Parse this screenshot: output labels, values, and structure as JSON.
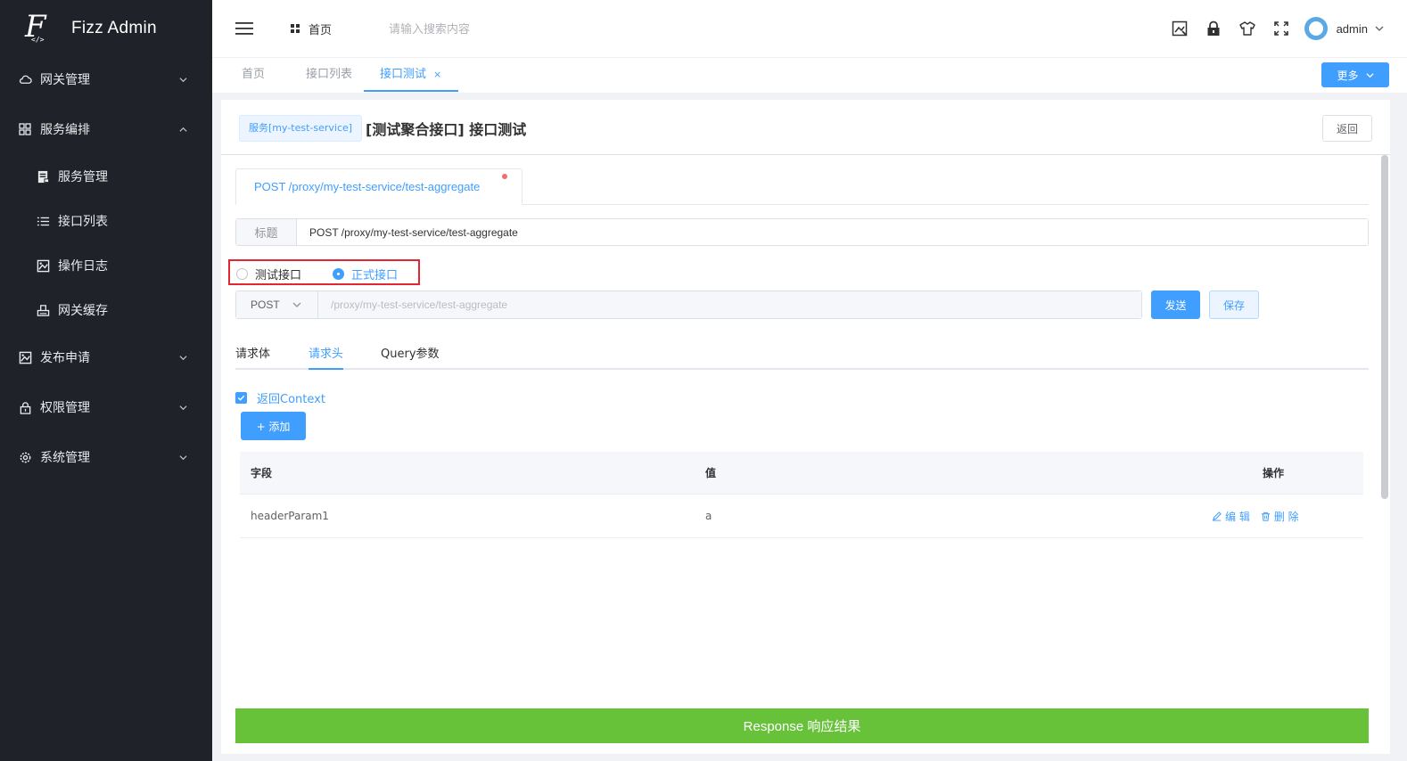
{
  "app": {
    "title": "Fizz Admin",
    "logo_code": "</>"
  },
  "sidebar": {
    "items": [
      {
        "label": "网关管理",
        "icon": "cloud-icon",
        "expanded": false
      },
      {
        "label": "服务编排",
        "icon": "grid-icon",
        "expanded": true
      },
      {
        "label": "发布申请",
        "icon": "image-icon",
        "expanded": false
      },
      {
        "label": "权限管理",
        "icon": "lock-icon",
        "expanded": false
      },
      {
        "label": "系统管理",
        "icon": "gear-icon",
        "expanded": false
      }
    ],
    "sub_items": [
      {
        "label": "服务管理",
        "icon": "document-icon"
      },
      {
        "label": "接口列表",
        "icon": "list-icon"
      },
      {
        "label": "操作日志",
        "icon": "image-icon"
      },
      {
        "label": "网关缓存",
        "icon": "printer-icon"
      }
    ]
  },
  "header": {
    "home_label": "首页",
    "search_placeholder": "请输入搜索内容",
    "user_name": "admin"
  },
  "tabs": {
    "items": [
      {
        "label": "首页",
        "active": false
      },
      {
        "label": "接口列表",
        "active": false
      },
      {
        "label": "接口测试",
        "active": true,
        "close": "×"
      }
    ],
    "more_label": "更多"
  },
  "page": {
    "service_tag": "服务[my-test-service]",
    "title": "[测试聚合接口] 接口测试",
    "back_label": "返回",
    "api_tab": "POST /proxy/my-test-service/test-aggregate",
    "title_label": "标题",
    "title_value": "POST /proxy/my-test-service/test-aggregate",
    "radio_test": "测试接口",
    "radio_prod": "正式接口",
    "radio_selected": "正式接口",
    "method": "POST",
    "url_placeholder": "/proxy/my-test-service/test-aggregate",
    "send_label": "发送",
    "save_label": "保存",
    "sub_tabs": [
      {
        "label": "请求体",
        "active": false
      },
      {
        "label": "请求头",
        "active": true
      },
      {
        "label": "Query参数",
        "active": false
      }
    ],
    "return_context_label": "返回Context",
    "return_context_checked": true,
    "add_label": "+ 添加",
    "table": {
      "headers": {
        "field": "字段",
        "value": "值",
        "ops": "操作"
      },
      "rows": [
        {
          "field": "headerParam1",
          "value": "a"
        }
      ],
      "edit_label": "编 辑",
      "delete_label": "删 除"
    },
    "response_label": "Response 响应结果"
  },
  "colors": {
    "primary": "#409eff",
    "sidebar_bg": "#1f2329",
    "response_green": "#67c23a",
    "highlight_red": "#e3262f"
  }
}
